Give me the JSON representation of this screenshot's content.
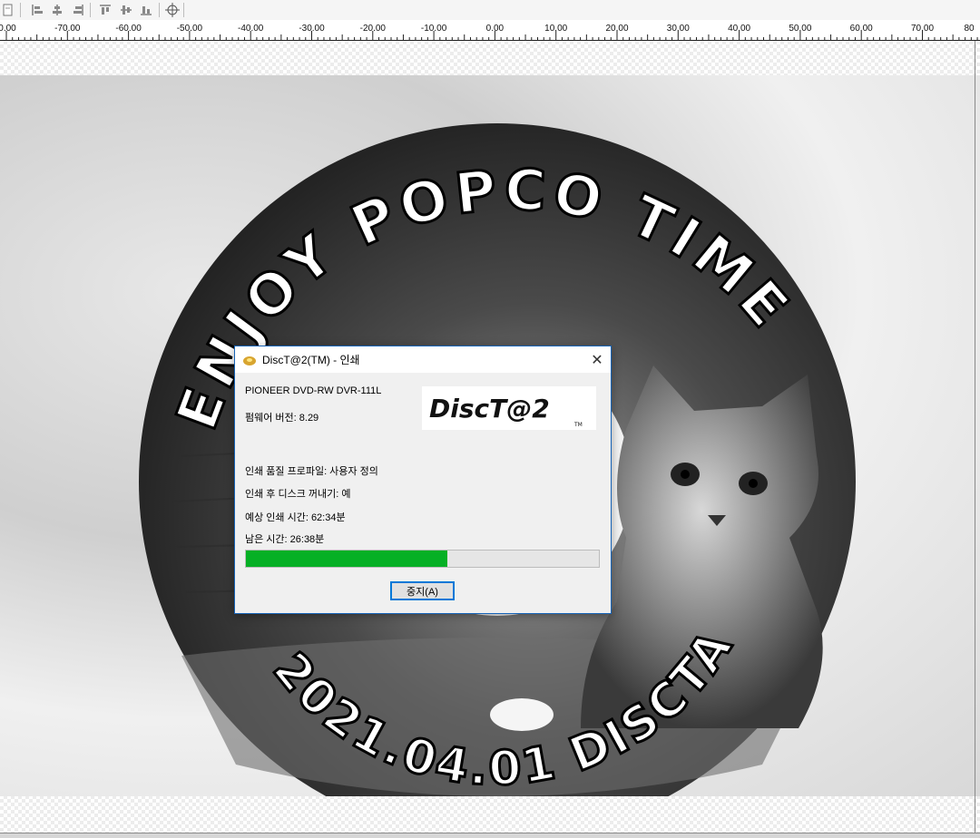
{
  "toolbar": {
    "buttons": [
      {
        "name": "page-setup-icon"
      },
      {
        "name": "align-left-icon"
      },
      {
        "name": "align-center-horizontal-icon"
      },
      {
        "name": "align-right-icon"
      },
      {
        "name": "align-top-icon"
      },
      {
        "name": "align-middle-icon"
      },
      {
        "name": "align-bottom-icon"
      },
      {
        "name": "center-object-icon"
      }
    ]
  },
  "ruler": {
    "labels": [
      "0.00",
      "-70.00",
      "-60.00",
      "-50.00",
      "-40.00",
      "-30.00",
      "-20.00",
      "-10.00",
      "0.00",
      "10.00",
      "20.00",
      "30.00",
      "40.00",
      "50.00",
      "60.00",
      "70.00",
      "80"
    ]
  },
  "disc": {
    "top_text": "ENJOY POPCO TIME",
    "bottom_text": "2021.04.01 DISCTATTOO"
  },
  "dialog": {
    "title": "DiscT@2(TM) - 인쇄",
    "close_icon": "close-icon",
    "device": "PIONEER DVD-RW  DVR-111L",
    "firmware": "펌웨어 버전: 8.29",
    "profile": "인쇄 품질 프로파일: 사용자 정의",
    "eject": "인쇄 후 디스크 꺼내기: 예",
    "estimated": "예상 인쇄 시간: 62:34분",
    "remaining": "남은 시간: 26:38분",
    "progress_percent": 57,
    "stop_label": "중지(A)",
    "logo": {
      "main": "DiscT@2",
      "tm": "TM"
    },
    "colors": {
      "progress": "#06b025",
      "logo_red": "#d8262b",
      "accent": "#0078d7"
    }
  }
}
